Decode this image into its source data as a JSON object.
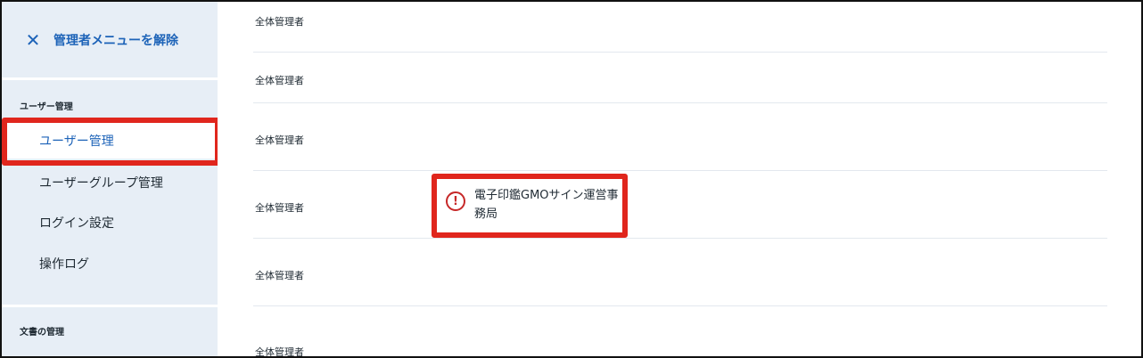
{
  "sidebar": {
    "exit_admin_menu": {
      "icon": "close-icon",
      "label": "管理者メニューを解除"
    },
    "sections": [
      {
        "heading": "ユーザー管理",
        "items": [
          {
            "label": "ユーザー管理",
            "active": true
          },
          {
            "label": "ユーザーグループ管理",
            "active": false
          },
          {
            "label": "ログイン設定",
            "active": false
          },
          {
            "label": "操作ログ",
            "active": false
          }
        ]
      },
      {
        "heading": "文書の管理",
        "items": [
          {
            "label": "…"
          }
        ]
      }
    ]
  },
  "main": {
    "rows": [
      {
        "role": "全体管理者"
      },
      {
        "role": "全体管理者"
      },
      {
        "role": "全体管理者"
      },
      {
        "role": "全体管理者"
      },
      {
        "role": "全体管理者"
      },
      {
        "role": "全体管理者"
      }
    ],
    "notice": {
      "icon": "exclamation-circle-icon",
      "text": "電子印鑑GMOサイン運営事務局"
    }
  },
  "colors": {
    "accent": "#1d63b8",
    "sidebar_bg": "#e7eef6",
    "highlight": "#e0261d",
    "warning": "#c62828"
  }
}
